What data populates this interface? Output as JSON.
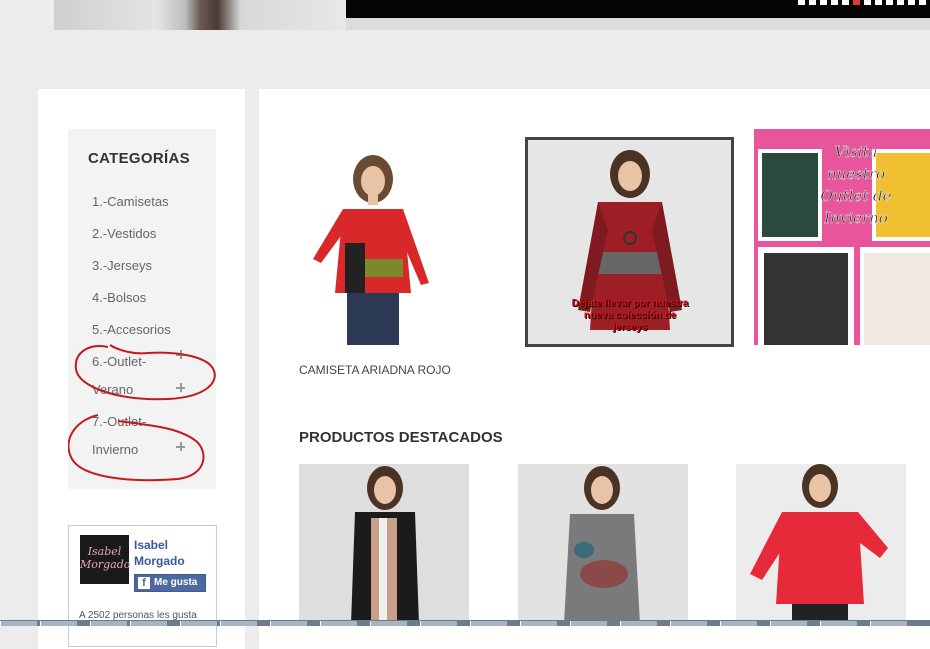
{
  "banner": {
    "slide_dots": 12,
    "active_dot": 5,
    "accent": "#d93a3a"
  },
  "sidebar": {
    "categories_title": "CATEGORÍAS",
    "categories": [
      {
        "label": "1.-Camisetas",
        "expandable": false
      },
      {
        "label": "2.-Vestidos",
        "expandable": false
      },
      {
        "label": "3.-Jerseys",
        "expandable": false
      },
      {
        "label": "4.-Bolsos",
        "expandable": false
      },
      {
        "label": "5.-Accesorios",
        "expandable": false
      },
      {
        "label_line1": "6.-Outlet-",
        "label_line2": "Verano",
        "expandable": true
      },
      {
        "label_line1": "7.-Outlet-",
        "label_line2": "Invierno",
        "expandable": true
      }
    ],
    "annotation_color": "#c41a1a"
  },
  "facebook": {
    "logo_line1": "Isabel",
    "logo_line2": "Morgado",
    "page_name": "Isabel Morgado",
    "like_label": "Me gusta",
    "like_count_text": "A 2502 personas les gusta",
    "brand_color": "#3b5998"
  },
  "main": {
    "featured_caption": "CAMISETA ARIADNA ROJO",
    "promo_jerseys_text": "Déjate llevar por nuestra nueva colección de jerseys",
    "promo_outlet_text": "Visita nuestro Outlet de Invierno",
    "section_title": "PRODUCTOS DESTACADOS"
  },
  "icons": [
    "plus-icon",
    "facebook-f-icon"
  ]
}
